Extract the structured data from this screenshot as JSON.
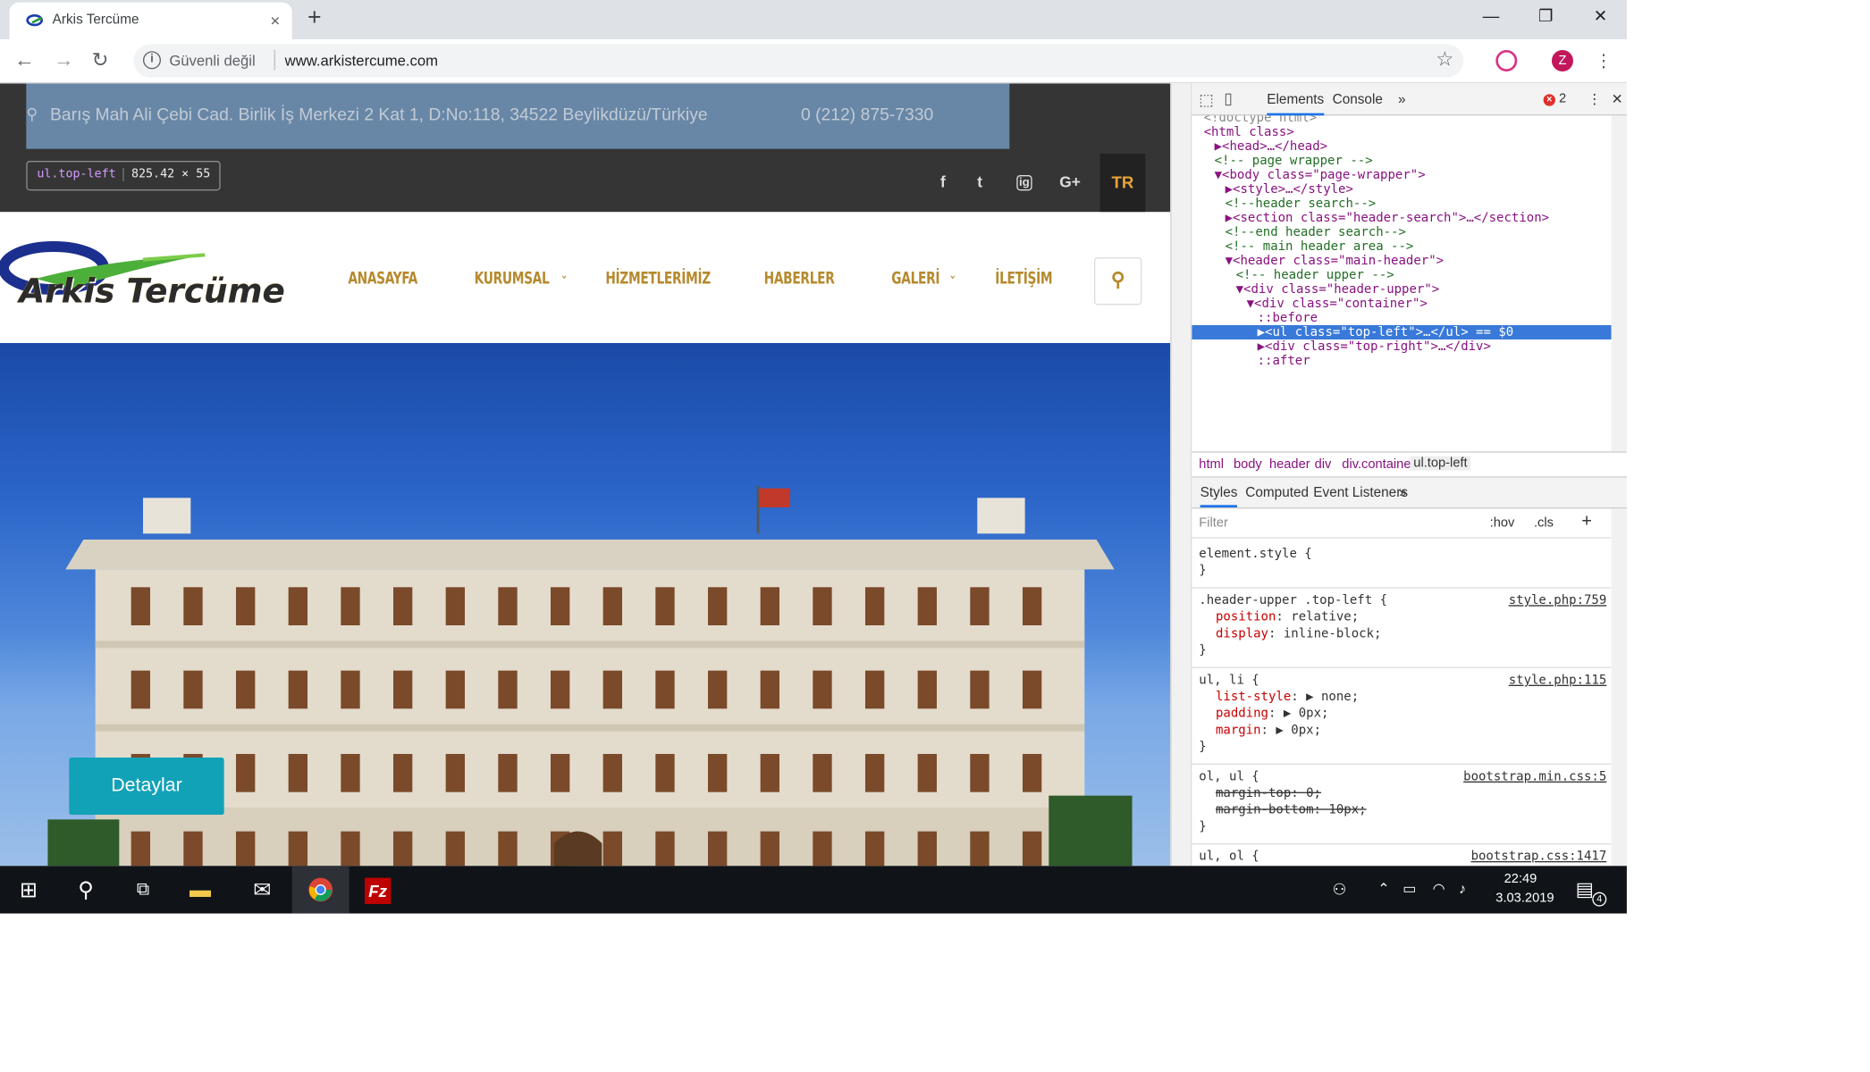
{
  "browser": {
    "tab_title": "Arkis Tercüme",
    "tab_close": "×",
    "new_tab": "+",
    "security_label": "Güvenli değil",
    "url": "www.arkistercume.com",
    "profile_initial": "Z",
    "window_buttons": [
      "—",
      "❐",
      "✕"
    ]
  },
  "site": {
    "address": "Barış Mah Ali Çebi Cad. Birlik İş Merkezi 2 Kat 1, D:No:118, 34522 Beylikdüzü/Türkiye",
    "phone": "0 (212) 875-7330",
    "inspect_tooltip": {
      "selector": "ul.top-left",
      "size": "825.42 × 55"
    },
    "social": [
      "f",
      "t",
      "ig",
      "G+"
    ],
    "lang": "TR",
    "logo_text": "Arkis Tercüme",
    "menu": [
      {
        "label": "ANASAYFA",
        "dropdown": false
      },
      {
        "label": "KURUMSAL",
        "dropdown": true
      },
      {
        "label": "HİZMETLERİMİZ",
        "dropdown": false
      },
      {
        "label": "HABERLER",
        "dropdown": false
      },
      {
        "label": "GALERİ",
        "dropdown": true
      },
      {
        "label": "İLETİŞİM",
        "dropdown": false
      }
    ],
    "hero_button": "Detaylar"
  },
  "devtools": {
    "tabs": [
      "Elements",
      "Console"
    ],
    "more": "»",
    "error_count": "2",
    "dom": [
      {
        "t": "<!doctype html>",
        "cls": "gr",
        "indent": 0
      },
      {
        "t": "<html class>",
        "cls": "tg",
        "indent": 0
      },
      {
        "t": "▶<head>…</head>",
        "cls": "tg",
        "indent": 1
      },
      {
        "t": "<!-- page wrapper -->",
        "cls": "cm",
        "indent": 1
      },
      {
        "t": "▼<body class=\"page-wrapper\">",
        "cls": "tg",
        "indent": 1
      },
      {
        "t": "▶<style>…</style>",
        "cls": "tg",
        "indent": 2
      },
      {
        "t": "<!--header search-->",
        "cls": "cm",
        "indent": 2
      },
      {
        "t": "▶<section class=\"header-search\">…</section>",
        "cls": "tg",
        "indent": 2
      },
      {
        "t": "<!--end header search-->",
        "cls": "cm",
        "indent": 2
      },
      {
        "t": "<!-- main header area -->",
        "cls": "cm",
        "indent": 2
      },
      {
        "t": "▼<header class=\"main-header\">",
        "cls": "tg",
        "indent": 2
      },
      {
        "t": "<!-- header upper -->",
        "cls": "cm",
        "indent": 3
      },
      {
        "t": "▼<div class=\"header-upper\">",
        "cls": "tg",
        "indent": 3
      },
      {
        "t": "▼<div class=\"container\">",
        "cls": "tg",
        "indent": 4
      },
      {
        "t": "::before",
        "cls": "ps",
        "indent": 5
      },
      {
        "t": "▶<ul class=\"top-left\">…</ul> == $0",
        "cls": "tg",
        "indent": 5,
        "selected": true
      },
      {
        "t": "▶<div class=\"top-right\">…</div>",
        "cls": "tg",
        "indent": 5
      },
      {
        "t": "::after",
        "cls": "ps",
        "indent": 5
      }
    ],
    "breadcrumbs": [
      "html",
      "body",
      "header",
      "div",
      "div.container",
      "ul.top-left"
    ],
    "style_tabs": [
      "Styles",
      "Computed",
      "Event Listeners"
    ],
    "filter_placeholder": "Filter",
    "hov": ":hov",
    "cls": ".cls",
    "plus": "+",
    "rules": [
      {
        "selector": "element.style {",
        "source": "",
        "props": [],
        "close": "}"
      },
      {
        "selector": ".header-upper .top-left {",
        "source": "style.php:759",
        "props": [
          {
            "name": "position",
            "value": "relative;",
            "strike": false
          },
          {
            "name": "display",
            "value": "inline-block;",
            "strike": false
          }
        ],
        "close": "}"
      },
      {
        "selector": "ul, li {",
        "source": "style.php:115",
        "props": [
          {
            "name": "list-style",
            "value": "▶ none;",
            "strike": false
          },
          {
            "name": "padding",
            "value": "▶ 0px;",
            "strike": false
          },
          {
            "name": "margin",
            "value": "▶ 0px;",
            "strike": false
          }
        ],
        "close": "}"
      },
      {
        "selector": "ol, ul {",
        "source": "bootstrap.min.css:5",
        "props": [
          {
            "name": "margin-top",
            "value": "0;",
            "strike": true
          },
          {
            "name": "margin-bottom",
            "value": "10px;",
            "strike": true
          }
        ],
        "close": "}"
      },
      {
        "selector": "ul, ol {",
        "source": "bootstrap.css:1417",
        "props": [],
        "close": ""
      }
    ]
  },
  "taskbar": {
    "time": "22:49",
    "date": "3.03.2019",
    "notifications": "4"
  },
  "colors": {
    "gold": "#b68a2e",
    "topbar": "#353535",
    "cta": "#12a2b8"
  }
}
